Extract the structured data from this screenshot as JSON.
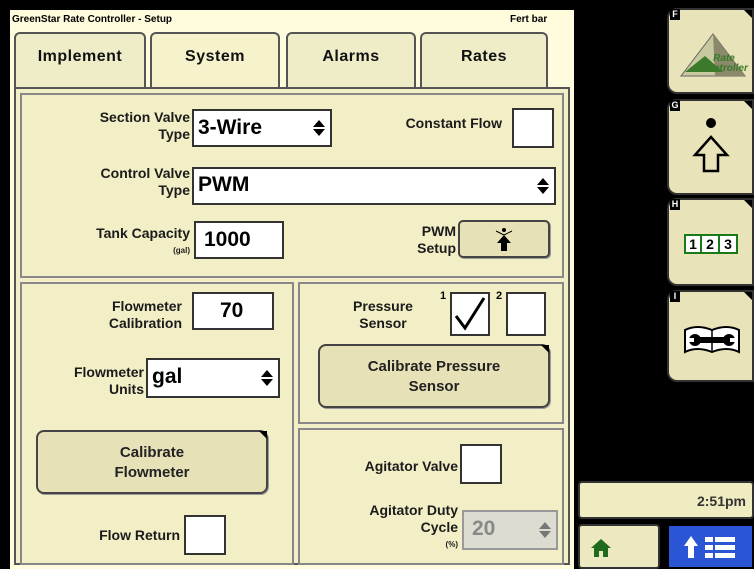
{
  "titlebar": {
    "app_title": "GreenStar Rate Controller - Setup",
    "implement_name": "Fert bar"
  },
  "tabs": [
    {
      "label": "Implement",
      "active": false
    },
    {
      "label": "System",
      "active": true
    },
    {
      "label": "Alarms",
      "active": false
    },
    {
      "label": "Rates",
      "active": false
    }
  ],
  "section_valve": {
    "label_line1": "Section Valve",
    "label_line2": "Type",
    "value": "3-Wire"
  },
  "constant_flow": {
    "label": "Constant Flow",
    "checked": false
  },
  "control_valve": {
    "label_line1": "Control Valve",
    "label_line2": "Type",
    "value": "PWM"
  },
  "tank_capacity": {
    "label": "Tank Capacity",
    "unit": "(gal)",
    "value": "1000"
  },
  "pwm_setup": {
    "label_line1": "PWM",
    "label_line2": "Setup"
  },
  "flowmeter_calibration": {
    "label_line1": "Flowmeter",
    "label_line2": "Calibration",
    "value": "70"
  },
  "flowmeter_units": {
    "label_line1": "Flowmeter",
    "label_line2": "Units",
    "value": "gal"
  },
  "calibrate_flowmeter": {
    "label_line1": "Calibrate",
    "label_line2": "Flowmeter"
  },
  "flow_return": {
    "label": "Flow Return",
    "checked": false
  },
  "pressure_sensor": {
    "label_line1": "Pressure",
    "label_line2": "Sensor",
    "sensor1_label": "1",
    "sensor1_checked": true,
    "sensor2_label": "2",
    "sensor2_checked": false
  },
  "calibrate_pressure": {
    "label_line1": "Calibrate Pressure",
    "label_line2": "Sensor"
  },
  "agitator_valve": {
    "label": "Agitator Valve",
    "checked": false
  },
  "agitator_duty": {
    "label_line1": "Agitator Duty",
    "label_line2": "Cycle",
    "unit": "(%)",
    "value": "20"
  },
  "softkeys": [
    {
      "letter": "F",
      "icon": "rate-controller-logo",
      "logo_line1": "Rate",
      "logo_line2": "Controller"
    },
    {
      "letter": "G",
      "icon": "up-arrow-dot-icon"
    },
    {
      "letter": "H",
      "icon": "one-two-three-icon",
      "digits": [
        "1",
        "2",
        "3"
      ]
    },
    {
      "letter": "I",
      "icon": "manual-wrench-icon"
    }
  ],
  "status": {
    "time": "2:51pm"
  },
  "colors": {
    "background": "#fefcdc",
    "panel": "#f2efc7",
    "button": "#e6e1b6",
    "nav_active": "#2a55d4",
    "logo_green": "#3a7a2a"
  }
}
